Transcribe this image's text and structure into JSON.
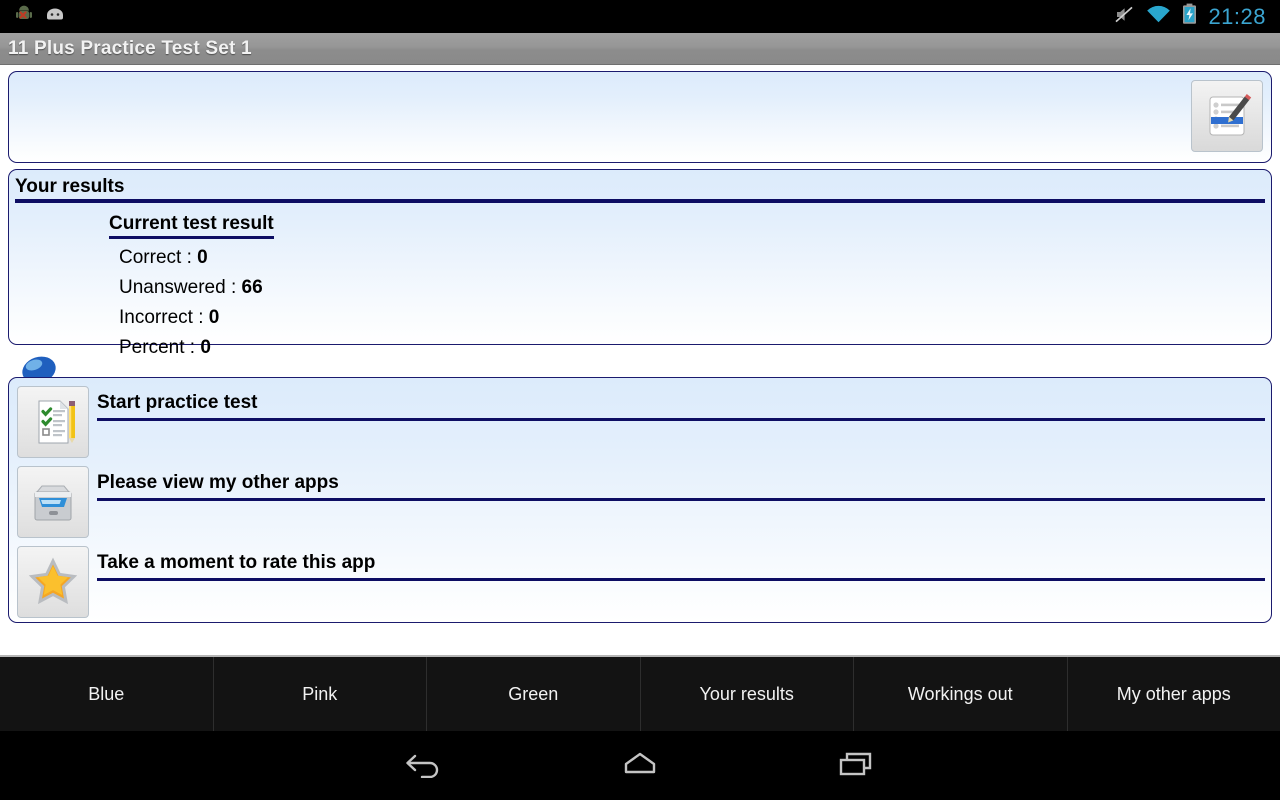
{
  "status_bar": {
    "notification_icons": [
      "android-error-icon",
      "android-head-icon"
    ],
    "system_icons": [
      "mute-icon",
      "wifi-icon",
      "battery-charging-icon"
    ],
    "clock": "21:28",
    "clock_color": "#3ba5d1"
  },
  "title_bar": {
    "title": "11 Plus Practice Test Set 1"
  },
  "banner": {
    "icon": "notepad-pencil-icon"
  },
  "results": {
    "section_heading": "Your results",
    "card_title": "Current test result",
    "rows": [
      {
        "label": "Correct :",
        "value": "0"
      },
      {
        "label": "Unanswered :",
        "value": "66"
      },
      {
        "label": "Incorrect :",
        "value": "0"
      },
      {
        "label": "Percent :",
        "value": "0"
      }
    ],
    "accent_color": "#0d0d63"
  },
  "pin": {
    "icon": "blue-pushpin-icon"
  },
  "menu": {
    "items": [
      {
        "label": "Start practice test",
        "icon": "checklist-pencil-icon"
      },
      {
        "label": "Please view my other apps",
        "icon": "file-drawer-icon"
      },
      {
        "label": "Take a moment to rate this app",
        "icon": "star-icon"
      }
    ]
  },
  "tabs": [
    {
      "label": "Blue"
    },
    {
      "label": "Pink"
    },
    {
      "label": "Green"
    },
    {
      "label": "Your results"
    },
    {
      "label": "Workings out"
    },
    {
      "label": "My other apps"
    }
  ],
  "nav_bar": {
    "buttons": [
      "back-icon",
      "home-icon",
      "recent-apps-icon"
    ]
  }
}
